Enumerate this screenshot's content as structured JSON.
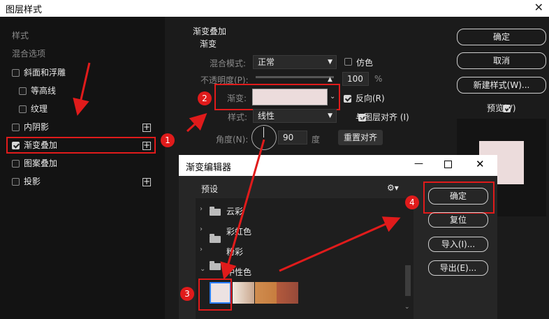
{
  "window": {
    "title": "图层样式",
    "close": "✕"
  },
  "left_panel": {
    "header": "样式",
    "blend": "混合选项",
    "items": [
      {
        "label": "斜面和浮雕"
      },
      {
        "label": "等高线"
      },
      {
        "label": "纹理"
      },
      {
        "label": "内阴影"
      },
      {
        "label": "渐变叠加"
      },
      {
        "label": "图案叠加"
      },
      {
        "label": "投影"
      }
    ]
  },
  "gradient_overlay": {
    "section_title": "渐变叠加",
    "subsection": "渐变",
    "blend_mode_label": "混合模式:",
    "blend_mode_value": "正常",
    "dither_label": "仿色",
    "opacity_label": "不透明度(P):",
    "opacity_value": "100",
    "opacity_unit": "%",
    "gradient_label": "渐变:",
    "gradient_color": "#ecdcdc",
    "reverse_label": "反向(R)",
    "style_label": "样式:",
    "style_value": "线性",
    "align_label": "与图层对齐 (I)",
    "angle_label": "角度(N):",
    "angle_value": "90",
    "angle_unit": "度",
    "reset_align": "重置对齐"
  },
  "right_buttons": {
    "ok": "确定",
    "cancel": "取消",
    "new_style": "新建样式(W)...",
    "preview": "预览(V)"
  },
  "preview_color": "#ecdcdc",
  "gradient_editor": {
    "title": "渐变编辑器",
    "minimize": "—",
    "close": "✕",
    "presets_label": "预设",
    "folders": [
      "云彩",
      "彩虹色",
      "粉彩",
      "中性色"
    ],
    "swatches": [
      "#ece2e2",
      "#dcc3ad",
      "#c98448",
      "#a5523b"
    ],
    "ok": "确定",
    "reset": "复位",
    "import": "导入(I)...",
    "export": "导出(E)..."
  },
  "badges": [
    "1",
    "2",
    "3",
    "4"
  ]
}
